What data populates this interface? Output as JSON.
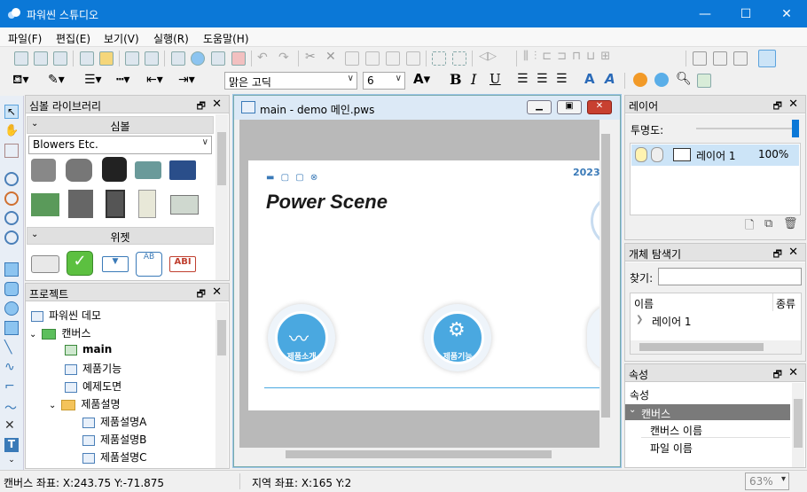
{
  "window": {
    "title": "파워씬 스튜디오"
  },
  "menu": [
    "파일(F)",
    "편집(E)",
    "보기(V)",
    "실행(R)",
    "도움말(H)"
  ],
  "format": {
    "font_name": "맑은 고딕",
    "font_size": "6"
  },
  "symbol_panel": {
    "title": "심볼 라이브러리",
    "section_symbols": "심볼",
    "category": "Blowers Etc.",
    "section_widgets": "위젯"
  },
  "project_panel": {
    "title": "프로젝트",
    "items": [
      {
        "label": "파워씬 데모"
      },
      {
        "label": "캔버스"
      },
      {
        "label": "main"
      },
      {
        "label": "제품기능"
      },
      {
        "label": "예제도면"
      },
      {
        "label": "제품설명"
      },
      {
        "label": "제품설명A"
      },
      {
        "label": "제품설명B"
      },
      {
        "label": "제품설명C"
      }
    ]
  },
  "document": {
    "title": "main - demo 메인.pws",
    "brand": "Power Scene",
    "date_partial": "2023/",
    "button1": "제품소개",
    "button2": "제품기능"
  },
  "layer_panel": {
    "title": "레이어",
    "opacity_label": "투명도:",
    "layer_name": "레이어 1",
    "layer_opacity": "100%"
  },
  "explorer_panel": {
    "title": "개체 탐색기",
    "find_label": "찾기:",
    "col_name": "이름",
    "col_type": "종류",
    "row1": "레이어 1"
  },
  "props_panel": {
    "title": "속성",
    "header": "속성",
    "group": "캔버스",
    "row1": "캔버스 이름",
    "row2": "파일 이름"
  },
  "status": {
    "canvas_coord": "캔버스 좌표: X:243.75 Y:-71.875",
    "region_coord": "지역 좌표: X:165 Y:2",
    "zoom": "63%"
  },
  "colors": {
    "accent": "#0b78d7",
    "selection": "#cce4f7",
    "brand_blue": "#1a5ea8"
  }
}
